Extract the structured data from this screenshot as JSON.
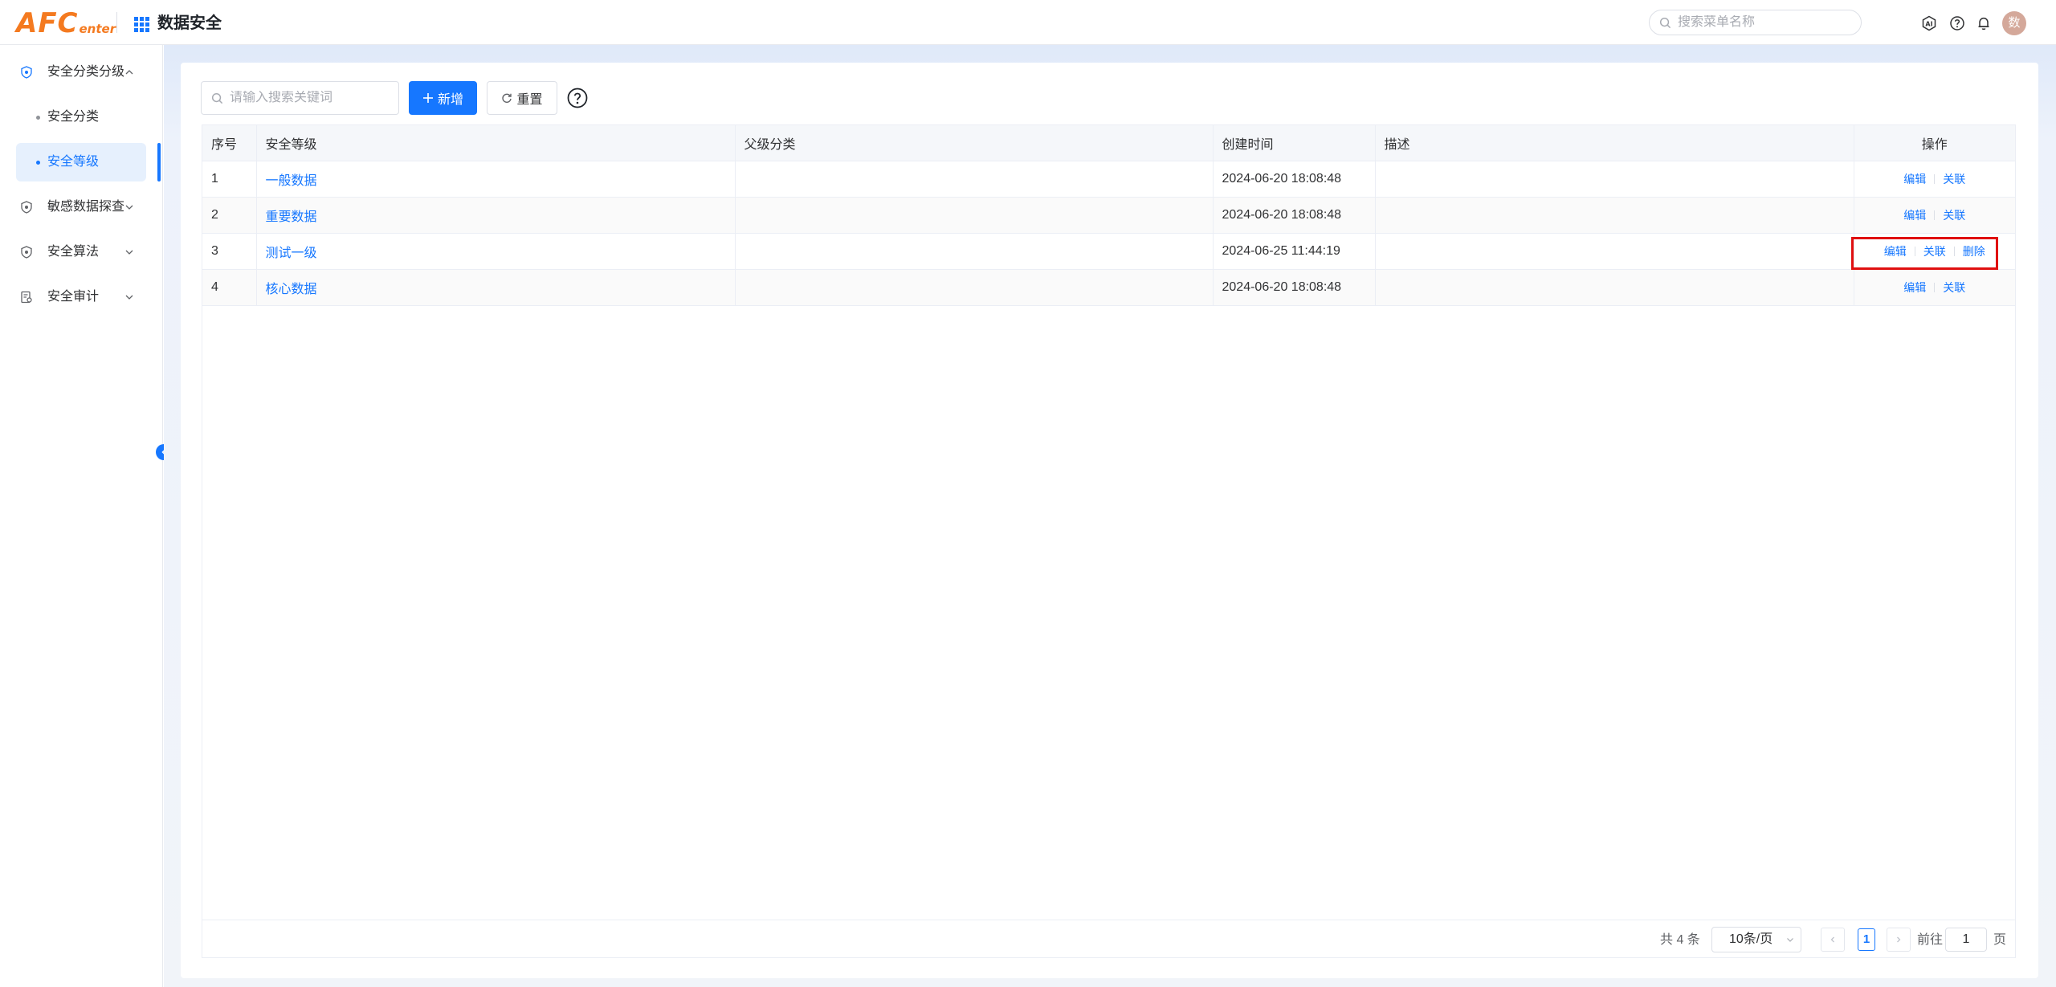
{
  "header": {
    "logo_big": "AFC",
    "logo_small": "enter",
    "app_title": "数据安全",
    "menu_search_placeholder": "搜索菜单名称",
    "avatar_text": "数"
  },
  "sidebar": {
    "items": [
      {
        "label": "安全分类分级",
        "icon": "shield-icon",
        "expanded": true
      },
      {
        "label": "敏感数据探查",
        "icon": "shield-icon",
        "expanded": false
      },
      {
        "label": "安全算法",
        "icon": "shield-icon",
        "expanded": false
      },
      {
        "label": "安全审计",
        "icon": "audit-icon",
        "expanded": false
      }
    ],
    "sub_items": [
      {
        "label": "安全分类",
        "active": false
      },
      {
        "label": "安全等级",
        "active": true
      }
    ]
  },
  "toolbar": {
    "search_placeholder": "请输入搜索关键词",
    "add_label": "新增",
    "reset_label": "重置"
  },
  "table": {
    "columns": [
      "序号",
      "安全等级",
      "父级分类",
      "创建时间",
      "描述",
      "操作"
    ],
    "rows": [
      {
        "index": "1",
        "level": "一般数据",
        "parent": "",
        "created": "2024-06-20 18:08:48",
        "desc": "",
        "ops": [
          "编辑",
          "关联"
        ]
      },
      {
        "index": "2",
        "level": "重要数据",
        "parent": "",
        "created": "2024-06-20 18:08:48",
        "desc": "",
        "ops": [
          "编辑",
          "关联"
        ]
      },
      {
        "index": "3",
        "level": "测试一级",
        "parent": "",
        "created": "2024-06-25 11:44:19",
        "desc": "",
        "ops": [
          "编辑",
          "关联",
          "删除"
        ]
      },
      {
        "index": "4",
        "level": "核心数据",
        "parent": "",
        "created": "2024-06-20 18:08:48",
        "desc": "",
        "ops": [
          "编辑",
          "关联"
        ]
      }
    ]
  },
  "pagination": {
    "total_text": "共 4 条",
    "page_size": "10条/页",
    "current_page": "1",
    "goto_label": "前往",
    "goto_value": "1",
    "goto_suffix": "页"
  },
  "colors": {
    "primary": "#1677ff",
    "logo": "#f47a20",
    "highlight": "#e01010"
  }
}
